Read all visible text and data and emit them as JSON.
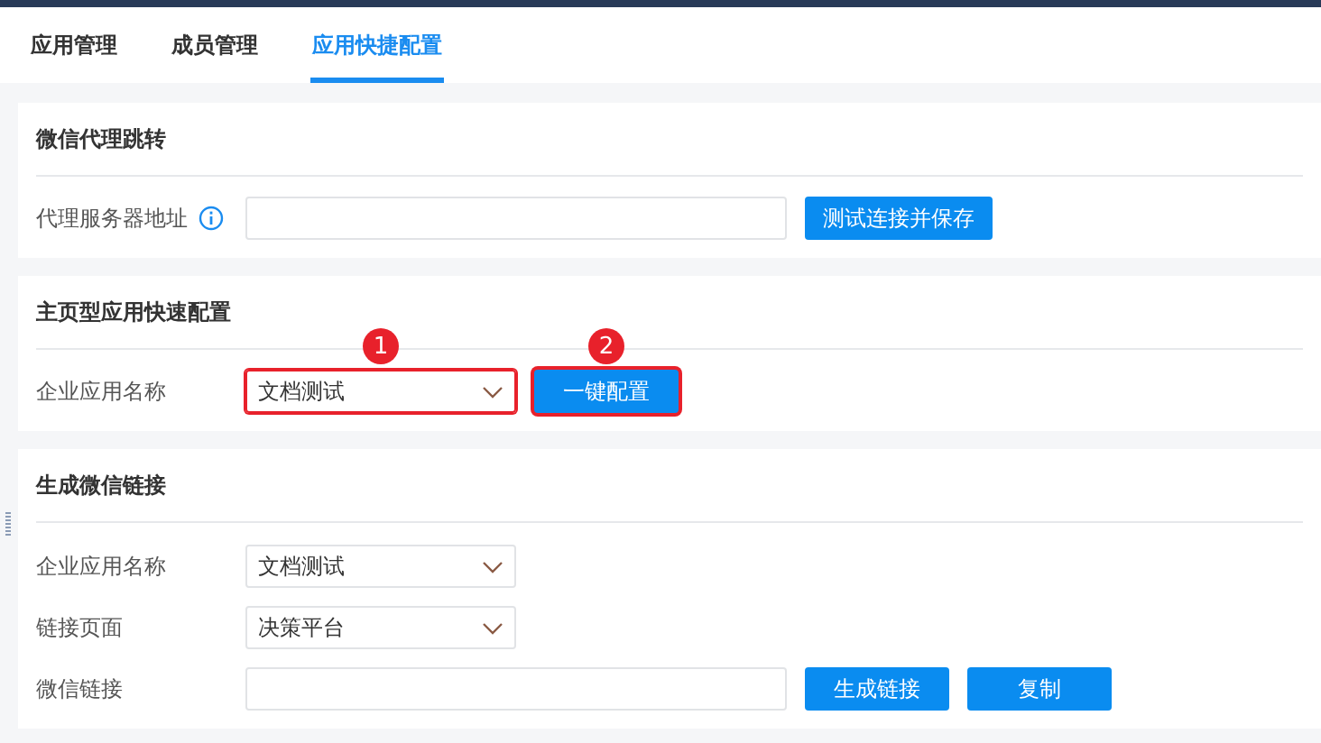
{
  "tabs": [
    {
      "label": "应用管理",
      "selected": false
    },
    {
      "label": "成员管理",
      "selected": false
    },
    {
      "label": "应用快捷配置",
      "selected": true
    }
  ],
  "sections": [
    {
      "title": "微信代理跳转",
      "rows": [
        {
          "label": "代理服务器地址",
          "info": true,
          "controls": [
            {
              "kind": "input",
              "highlighted": false
            },
            {
              "kind": "button",
              "label": "测试连接并保存",
              "highlighted": false
            }
          ]
        }
      ]
    },
    {
      "title": "主页型应用快速配置",
      "rows": [
        {
          "label": "企业应用名称",
          "info": false,
          "controls": [
            {
              "kind": "select",
              "value": "文档测试",
              "highlighted": true,
              "marker": "1"
            },
            {
              "kind": "button",
              "label": "一键配置",
              "highlighted": true,
              "marker": "2"
            }
          ]
        }
      ]
    },
    {
      "title": "生成微信链接",
      "rows": [
        {
          "label": "企业应用名称",
          "info": false,
          "controls": [
            {
              "kind": "select",
              "value": "文档测试",
              "highlighted": false
            }
          ]
        },
        {
          "label": "链接页面",
          "info": false,
          "controls": [
            {
              "kind": "select",
              "value": "决策平台",
              "highlighted": false
            }
          ]
        },
        {
          "label": "微信链接",
          "info": false,
          "controls": [
            {
              "kind": "input",
              "highlighted": false
            },
            {
              "kind": "button",
              "label": "生成链接",
              "highlighted": false
            },
            {
              "kind": "button",
              "label": "复制",
              "highlighted": false
            }
          ]
        }
      ]
    }
  ]
}
